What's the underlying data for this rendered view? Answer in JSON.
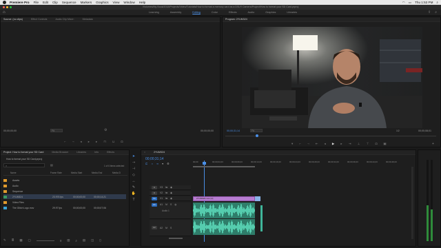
{
  "menubar": {
    "app": "Premiere Pro",
    "items": [
      "File",
      "Edit",
      "Clip",
      "Sequence",
      "Markers",
      "Graphics",
      "View",
      "Window",
      "Help"
    ],
    "clock": "Thu 1:53 PM"
  },
  "titlebar": {
    "path": "/Volumes/My Book/2018/Projects/Video/Tutorials/How to format a memory card as a DSLR Camera/Project/How to format your SD Card.prproj"
  },
  "workspaces": [
    "Learning",
    "Assembly",
    "Editing",
    "Color",
    "Effects",
    "Audio",
    "Graphics",
    "Libraries"
  ],
  "active_workspace": "Editing",
  "source": {
    "tabs": [
      "Source: (no clips)",
      "Effect Controls",
      "Audio Clip Mixer:",
      "Metadata"
    ],
    "tc_left": "00;00;00;00",
    "tc_right": "00;00;00;00",
    "fit": "Fit"
  },
  "program": {
    "tab": "Program: 2YUM324",
    "tc_left": "00;00;31;14",
    "fit": "Fit",
    "quality": "1/2",
    "tc_right": "00;00;08;01"
  },
  "project": {
    "tabs": [
      "Project: How to format your SD Card",
      "Media Browser",
      "Libraries",
      "Info",
      "Effects"
    ],
    "file": "How to format your SD Card.prproj",
    "selected": "1 of 6 items selected",
    "columns": [
      "Name",
      "Frame Rate",
      "Media Start",
      "Media End",
      "Media D"
    ],
    "items": [
      {
        "name": "Assets",
        "color": "#e09a2c",
        "rate": "",
        "start": "",
        "end": ""
      },
      {
        "name": "Audio",
        "color": "#e09a2c",
        "rate": "",
        "start": "",
        "end": ""
      },
      {
        "name": "Sequence",
        "color": "#e09a2c",
        "rate": "",
        "start": "",
        "end": ""
      },
      {
        "name": "2YUM324",
        "color": "#3a9a62",
        "rate": "23.976 fps",
        "start": "00;00;00;00",
        "end": "00;00;14;21"
      },
      {
        "name": "Video Files",
        "color": "#e09a2c",
        "rate": "",
        "start": "",
        "end": ""
      },
      {
        "name": "The Glitch Logo.mov",
        "color": "#3aa3d8",
        "rate": "29.97 fps",
        "start": "00;00;00;00",
        "end": "00;00;07;06"
      }
    ]
  },
  "timeline": {
    "tab": "2YUM324",
    "timecode": "00;00;31;14",
    "ruler": [
      "00;00",
      "00;00;04;23",
      "00;00;09;23",
      "00;00;14;23",
      "00;00;19;23",
      "00;00;24;23",
      "00;00;29;23",
      "00;00;34;23",
      "00;00;39;23",
      "00;00;44;23",
      "00;00;49;23"
    ],
    "video_tracks": [
      "V3",
      "V2",
      "V1"
    ],
    "audio_tracks": [
      "A1",
      "A2",
      "A3"
    ],
    "audio_label": "Audio 1",
    "clip_name": "2YUM324",
    "clip_label": "2YUM324.mov [V]"
  },
  "colors": {
    "accent": "#4a8fe7",
    "video_clip": "#b77cd1",
    "audio_clip": "#3fb59a",
    "bin": "#e09a2c"
  }
}
